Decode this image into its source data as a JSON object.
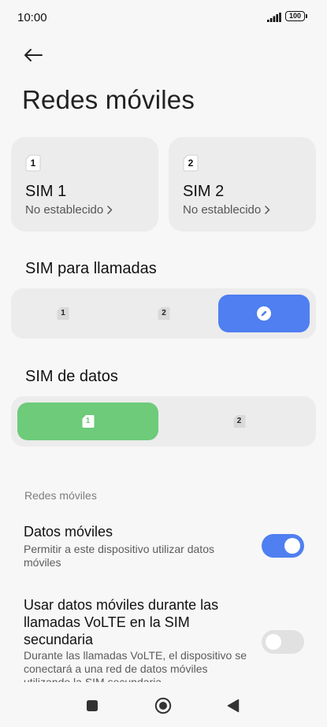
{
  "status_bar": {
    "time": "10:00",
    "battery": "100",
    "signal_icon": "signal-bars-icon",
    "battery_icon": "battery-icon"
  },
  "header": {
    "back_icon": "arrow-left-icon",
    "title": "Redes móviles"
  },
  "sim_cards": [
    {
      "slot": "1",
      "name": "SIM 1",
      "status": "No establecido"
    },
    {
      "slot": "2",
      "name": "SIM 2",
      "status": "No establecido"
    }
  ],
  "calls_section": {
    "heading": "SIM para llamadas",
    "options": [
      {
        "label": "1",
        "selected": false
      },
      {
        "label": "2",
        "selected": false
      },
      {
        "icon": "pencil-icon",
        "selected": true
      }
    ],
    "selected_color": "#4f7ff0"
  },
  "data_section": {
    "heading": "SIM de datos",
    "options": [
      {
        "label": "1",
        "selected": true
      },
      {
        "label": "2",
        "selected": false
      }
    ],
    "selected_color": "#6dcb79"
  },
  "settings": {
    "group_label": "Redes móviles",
    "items": [
      {
        "title": "Datos móviles",
        "description": "Permitir a este dispositivo utilizar datos móviles",
        "enabled": true
      },
      {
        "title": "Usar datos móviles durante las llamadas VoLTE en la SIM secundaria",
        "description": "Durante las llamadas VoLTE, el dispositivo se conectará a una red de datos móviles utilizando la SIM secundaria",
        "enabled": false
      }
    ],
    "toggle_on_color": "#4f7ff0",
    "toggle_off_color": "#e1e1e1"
  },
  "nav_bar": {
    "recents_icon": "square-recents-icon",
    "home_icon": "circle-home-icon",
    "back_icon": "triangle-back-icon"
  }
}
